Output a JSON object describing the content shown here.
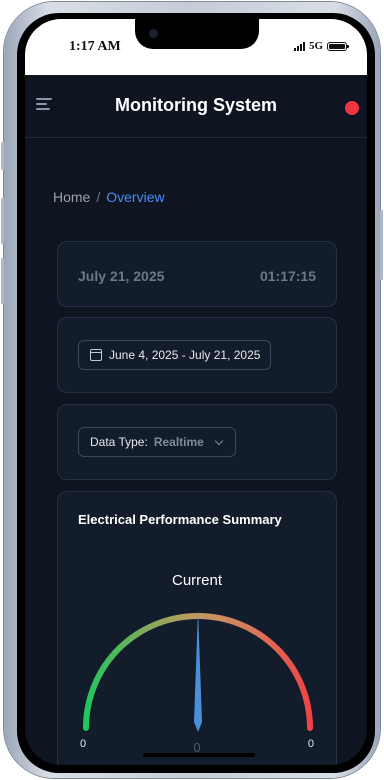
{
  "status_bar": {
    "time": "1:17 AM",
    "network": "5G"
  },
  "app": {
    "title": "Monitoring System",
    "status_color": "#ef3340"
  },
  "breadcrumb": {
    "home": "Home",
    "current": "Overview"
  },
  "datetime": {
    "date": "July 21, 2025",
    "time": "01:17:15"
  },
  "date_range": {
    "label": "June 4, 2025 - July 21, 2025",
    "icon": "calendar-icon"
  },
  "data_type": {
    "label": "Data Type:",
    "value": "Realtime"
  },
  "summary": {
    "title": "Electrical Performance Summary",
    "gauge": {
      "title": "Current",
      "min": "0",
      "max": "0",
      "value": "0"
    }
  },
  "colors": {
    "accent": "#4a8df7",
    "gauge_low": "#22c55e",
    "gauge_high": "#ef4444",
    "needle": "#4a90d9"
  }
}
